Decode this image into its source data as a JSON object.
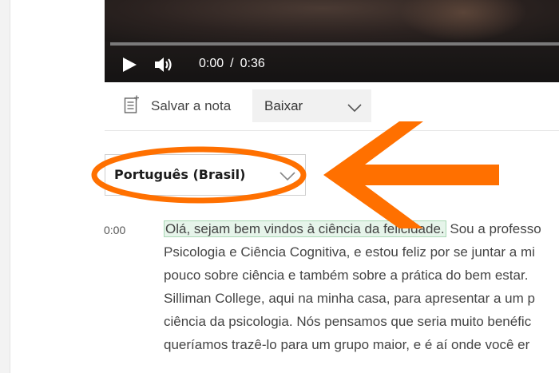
{
  "player": {
    "current_time": "0:00",
    "separator": "/",
    "duration": "0:36",
    "progress": 0,
    "play_icon": "play-icon",
    "volume_icon": "volume-icon"
  },
  "toolbar": {
    "note_label": "Salvar a nota",
    "note_icon": "note-icon",
    "download_label": "Baixar"
  },
  "language": {
    "selected": "Português (Brasil)"
  },
  "annotation": {
    "color": "#ff7000"
  },
  "transcript": {
    "timestamp": "0:00",
    "highlighted": "Olá, sejam bem vindos à ciência da felicidade.",
    "first_line_rest": " Sou a professo",
    "lines": [
      "Psicologia e Ciência Cognitiva, e estou feliz por se juntar a mi",
      "pouco sobre ciência e também sobre a prática do bem estar.",
      "Silliman College, aqui na minha casa, para apresentar a um p",
      "ciência da psicologia. Nós pensamos que seria muito benéfic",
      "queríamos trazê-lo para um grupo maior, e é aí onde você er"
    ]
  }
}
